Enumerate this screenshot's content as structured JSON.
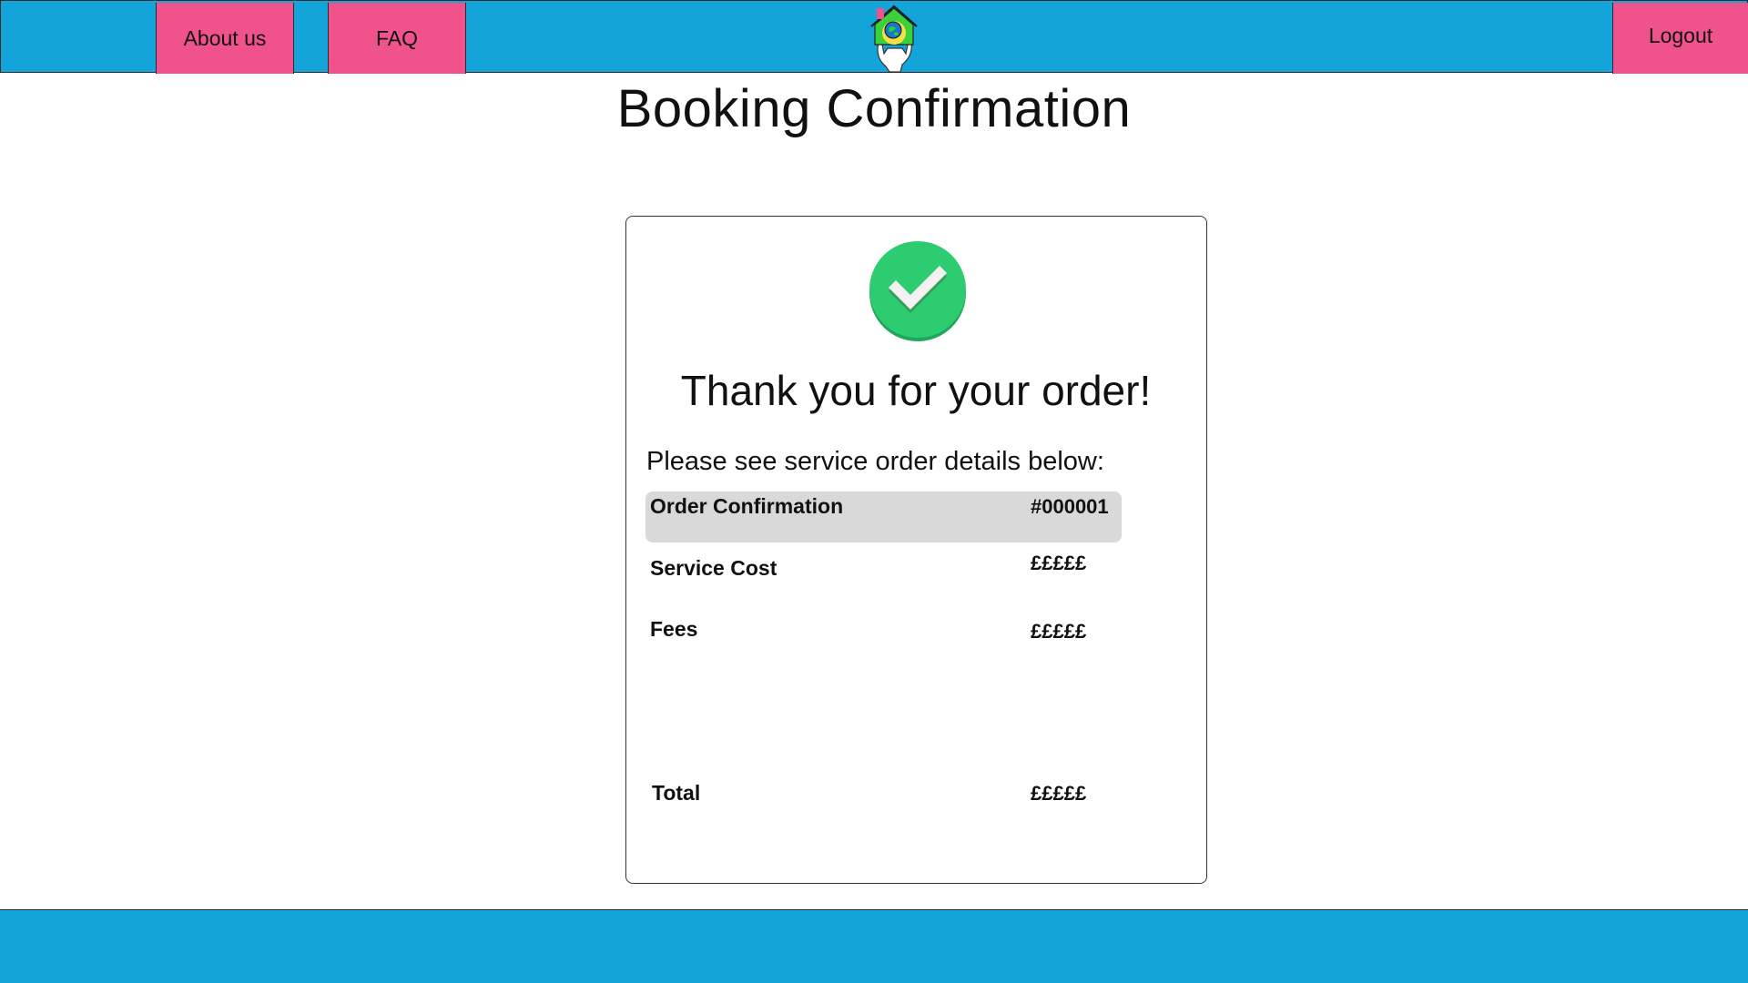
{
  "header": {
    "nav": {
      "about": "About us",
      "faq": "FAQ",
      "logout": "Logout"
    },
    "logo_icon": "house-globe-hand-logo"
  },
  "page": {
    "title": "Booking Confirmation"
  },
  "card": {
    "icon": "check-circle-icon",
    "thanks": "Thank you for your order!",
    "subtitle": "Please see service order details below:",
    "rows": [
      {
        "label": "Order Confirmation",
        "value": "#000001"
      },
      {
        "label": "Service Cost",
        "value": "£££££"
      },
      {
        "label": "Fees",
        "value": "£££££"
      }
    ],
    "total": {
      "label": "Total",
      "value": "£££££"
    }
  },
  "colors": {
    "header_blue": "#13a4da",
    "nav_pink": "#f0528c",
    "success_green": "#2ecc71",
    "row_highlight": "#d9d9d9"
  }
}
